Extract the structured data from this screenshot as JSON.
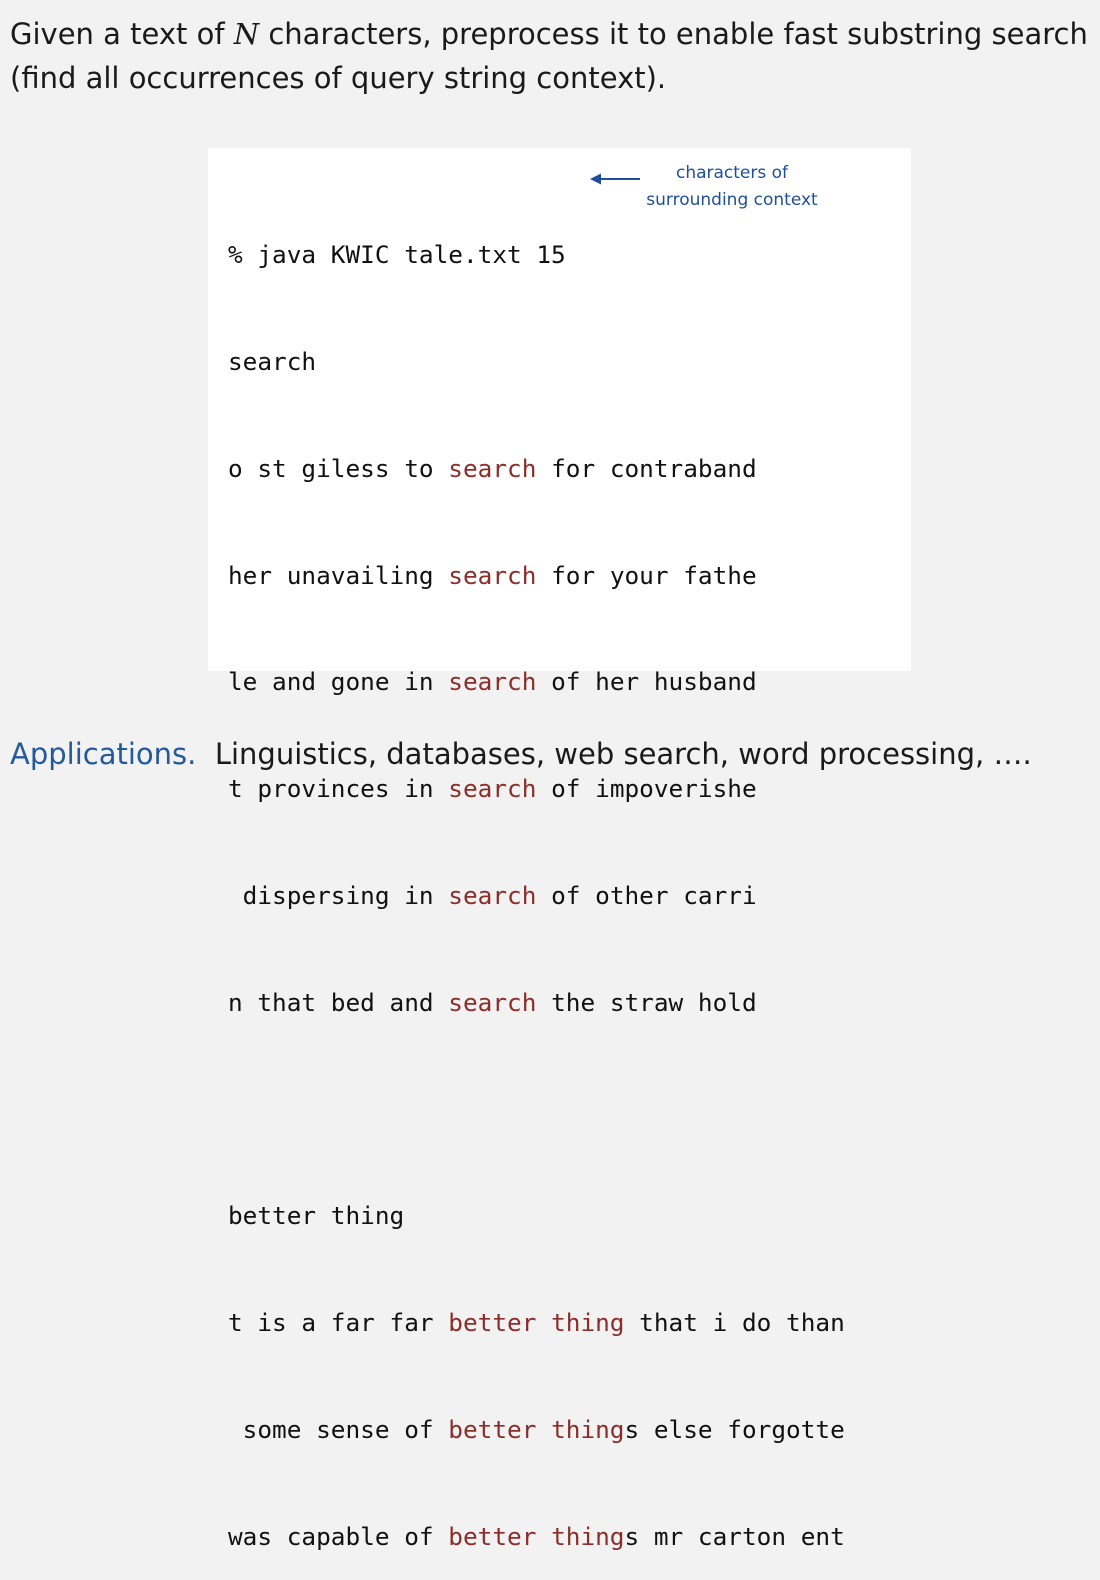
{
  "intro": {
    "before": "Given a text of ",
    "variable": "N",
    "after": " characters, preprocess it to enable fast substring search (find all occurrences of query string context)."
  },
  "command": "% java KWIC tale.txt 15",
  "annotation": {
    "line1": "characters of",
    "line2": "surrounding context"
  },
  "groups": [
    {
      "query": "search",
      "results": [
        {
          "before": "o st giless to ",
          "match": "search",
          "after": " for contraband"
        },
        {
          "before": "her unavailing ",
          "match": "search",
          "after": " for your fathe"
        },
        {
          "before": "le and gone in ",
          "match": "search",
          "after": " of her husband"
        },
        {
          "before": "t provinces in ",
          "match": "search",
          "after": " of impoverishe"
        },
        {
          "before": " dispersing in ",
          "match": "search",
          "after": " of other carri"
        },
        {
          "before": "n that bed and ",
          "match": "search",
          "after": " the straw hold"
        }
      ]
    },
    {
      "query": "better thing",
      "results": [
        {
          "before": "t is a far far ",
          "match": "better thing",
          "after": " that i do than"
        },
        {
          "before": " some sense of ",
          "match": "better thing",
          "after": "s else forgotte"
        },
        {
          "before": "was capable of ",
          "match": "better thing",
          "after": "s mr carton ent"
        }
      ]
    }
  ],
  "applications": {
    "label": "Applications.",
    "text": "Linguistics, databases, web search, word processing, …."
  },
  "colors": {
    "match": "#8b2e2a",
    "annotation": "#1f4f9a",
    "label": "#245a9c"
  }
}
